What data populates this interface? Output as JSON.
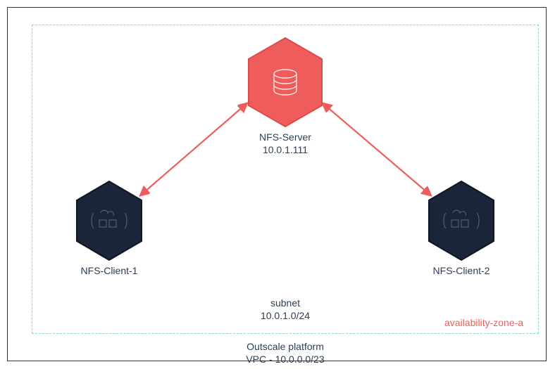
{
  "availability_zone": "availability-zone-a",
  "server": {
    "name": "NFS-Server",
    "ip": "10.0.1.111"
  },
  "clients": [
    {
      "name": "NFS-Client-1"
    },
    {
      "name": "NFS-Client-2"
    }
  ],
  "subnet": {
    "label": "subnet",
    "cidr": "10.0.1.0/24"
  },
  "platform": {
    "label": "Outscale platform",
    "vpc": "VPC - 10.0.0.0/23"
  },
  "colors": {
    "server_hex": "#ee5d5b",
    "client_hex": "#1b2539",
    "arrow": "#ee5d5b",
    "border": "#333",
    "dash": "#8fd6c5"
  }
}
